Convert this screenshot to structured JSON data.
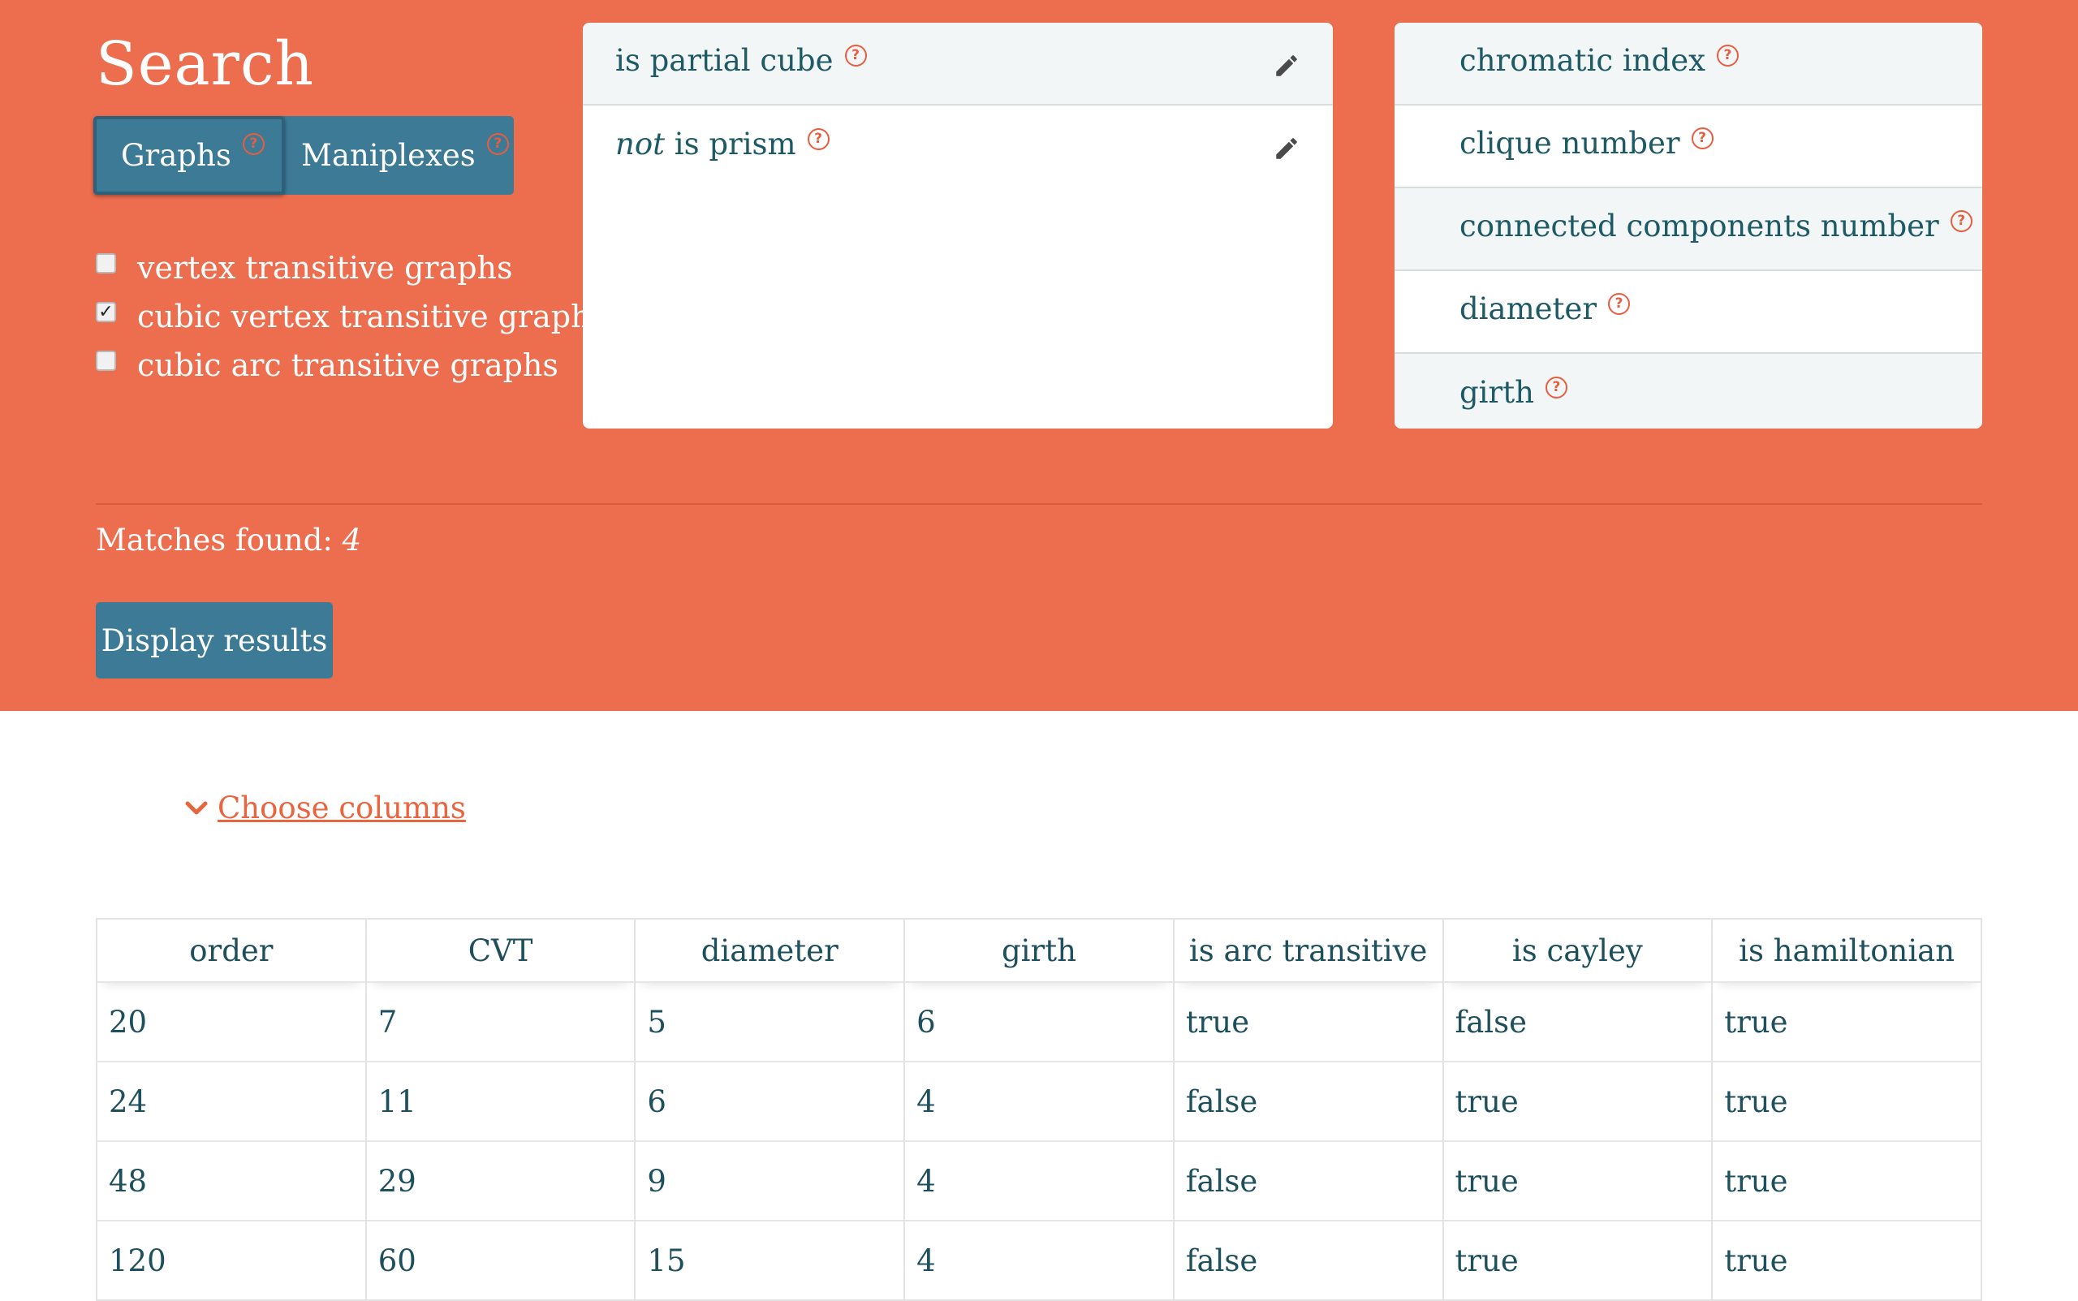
{
  "search": {
    "title": "Search",
    "tabs": [
      {
        "label": "Graphs",
        "active": true
      },
      {
        "label": "Maniplexes",
        "active": false
      }
    ],
    "help_icon": "question-circle-icon",
    "checkboxes": [
      {
        "label": "vertex transitive graphs",
        "checked": false
      },
      {
        "label": "cubic vertex transitive graphs",
        "checked": true
      },
      {
        "label": "cubic arc transitive graphs",
        "checked": false
      }
    ]
  },
  "filters": {
    "items": [
      {
        "prefix": "",
        "label": "is partial cube"
      },
      {
        "prefix": "not",
        "label": " is prism"
      }
    ]
  },
  "properties": {
    "items": [
      {
        "label": "chromatic index"
      },
      {
        "label": "clique number"
      },
      {
        "label": "connected components number"
      },
      {
        "label": "diameter"
      },
      {
        "label": "girth"
      }
    ]
  },
  "matches": {
    "label": "Matches found:",
    "count": "4"
  },
  "display_button": {
    "label": "Display results"
  },
  "choose_columns": {
    "label": "Choose columns"
  },
  "colors": {
    "header_bg": "#ed6d4f",
    "accent_button": "#3c7a95",
    "text_teal": "#1e5a66",
    "link_orange": "#e8653f"
  },
  "table": {
    "columns": [
      "order",
      "CVT",
      "diameter",
      "girth",
      "is arc transitive",
      "is cayley",
      "is hamiltonian"
    ],
    "rows": [
      [
        "20",
        "7",
        "5",
        "6",
        "true",
        "false",
        "true"
      ],
      [
        "24",
        "11",
        "6",
        "4",
        "false",
        "true",
        "true"
      ],
      [
        "48",
        "29",
        "9",
        "4",
        "false",
        "true",
        "true"
      ],
      [
        "120",
        "60",
        "15",
        "4",
        "false",
        "true",
        "true"
      ]
    ]
  }
}
